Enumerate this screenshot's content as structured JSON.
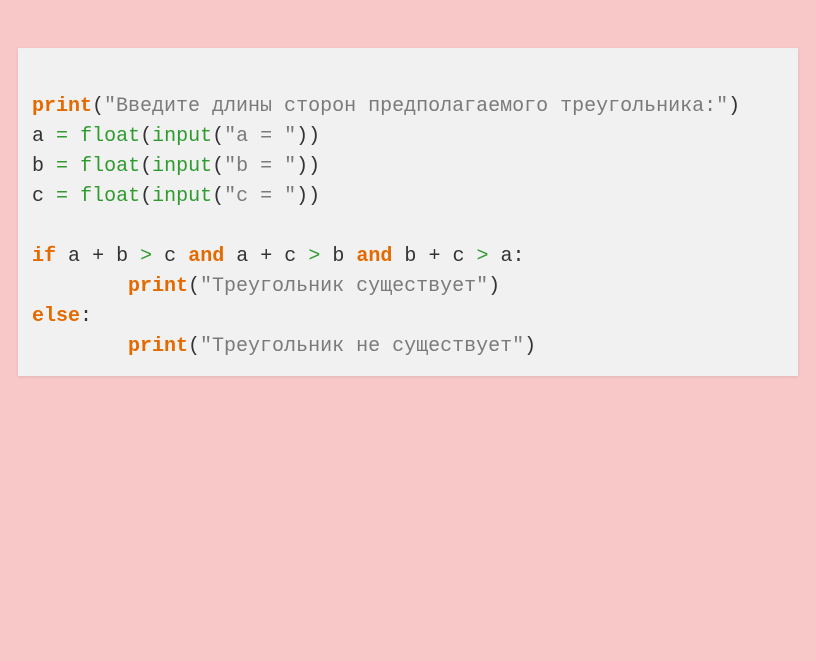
{
  "code": {
    "l1_print": "print",
    "l1_str": "\"Введите длины сторон предполагаемого треугольника:\"",
    "l2_a": "a",
    "l2_eq": "=",
    "l2_float": "float",
    "l2_input": "input",
    "l2_str": "\"a = \"",
    "l3_b": "b",
    "l3_eq": "=",
    "l3_float": "float",
    "l3_input": "input",
    "l3_str": "\"b = \"",
    "l4_c": "c",
    "l4_eq": "=",
    "l4_float": "float",
    "l4_input": "input",
    "l4_str": "\"c = \"",
    "l6_if": "if",
    "l6_a": "a",
    "l6_plus1": "+",
    "l6_b": "b",
    "l6_gt1": ">",
    "l6_c": "c",
    "l6_and1": "and",
    "l6_a2": "a",
    "l6_plus2": "+",
    "l6_c2": "c",
    "l6_gt2": ">",
    "l6_b2": "b",
    "l6_and2": "and",
    "l6_b3": "b",
    "l6_plus3": "+",
    "l6_c3": "c",
    "l6_gt3": ">",
    "l6_a3": "a",
    "l6_colon": ":",
    "l7_print": "print",
    "l7_str": "\"Треугольник существует\"",
    "l8_else": "else",
    "l8_colon": ":",
    "l9_print": "print",
    "l9_str": "\"Треугольник не существует\""
  }
}
